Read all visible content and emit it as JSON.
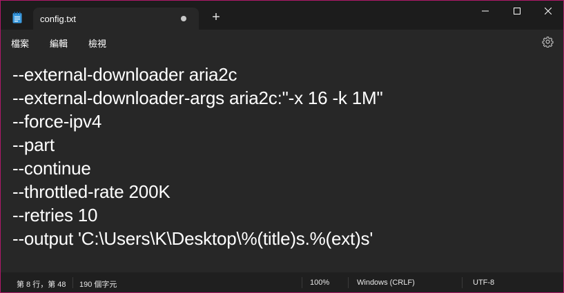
{
  "tab": {
    "title": "config.txt"
  },
  "window_controls": {
    "minimize": "—",
    "maximize": "☐",
    "close": "✕"
  },
  "new_tab_symbol": "+",
  "menu": [
    {
      "label": "檔案"
    },
    {
      "label": "編輯"
    },
    {
      "label": "檢視"
    }
  ],
  "editor": {
    "lines": [
      "--external-downloader aria2c",
      "--external-downloader-args aria2c:\"-x 16 -k 1M\"",
      "--force-ipv4",
      "--part",
      "--continue",
      "--throttled-rate 200K",
      "--retries 10",
      "--output 'C:\\Users\\K\\Desktop\\%(title)s.%(ext)s'"
    ]
  },
  "status": {
    "position": "第 8 行，第 48",
    "char_count": "190 個字元",
    "zoom": "100%",
    "line_ending": "Windows (CRLF)",
    "encoding": "UTF-8"
  },
  "colors": {
    "window_border": "#b0196a",
    "title_bar": "#1c1c1c",
    "editor_bg": "#272727",
    "status_bg": "#1f1f1f"
  },
  "icons": {
    "app": "notepad-icon",
    "settings": "gear-icon",
    "unsaved": "unsaved-dot-icon"
  }
}
